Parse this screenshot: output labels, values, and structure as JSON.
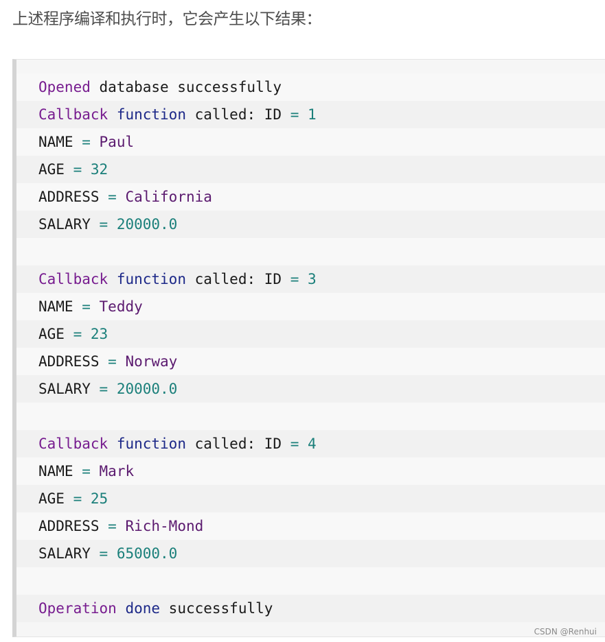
{
  "intro_text": "上述程序编译和执行时，它会产生以下结果：",
  "watermark": "CSDN @Renhui",
  "lines": [
    [
      {
        "t": "Opened",
        "c": "kw"
      },
      {
        "t": " database successfully",
        "c": "plain"
      }
    ],
    [
      {
        "t": "Callback",
        "c": "kw"
      },
      {
        "t": " ",
        "c": "plain"
      },
      {
        "t": "function",
        "c": "fn"
      },
      {
        "t": " called: ID ",
        "c": "plain"
      },
      {
        "t": "=",
        "c": "num"
      },
      {
        "t": " ",
        "c": "plain"
      },
      {
        "t": "1",
        "c": "num"
      }
    ],
    [
      {
        "t": "NAME ",
        "c": "plain"
      },
      {
        "t": "=",
        "c": "num"
      },
      {
        "t": " ",
        "c": "plain"
      },
      {
        "t": "Paul",
        "c": "str"
      }
    ],
    [
      {
        "t": "AGE ",
        "c": "plain"
      },
      {
        "t": "=",
        "c": "num"
      },
      {
        "t": " ",
        "c": "plain"
      },
      {
        "t": "32",
        "c": "num"
      }
    ],
    [
      {
        "t": "ADDRESS ",
        "c": "plain"
      },
      {
        "t": "=",
        "c": "num"
      },
      {
        "t": " ",
        "c": "plain"
      },
      {
        "t": "California",
        "c": "str"
      }
    ],
    [
      {
        "t": "SALARY ",
        "c": "plain"
      },
      {
        "t": "=",
        "c": "num"
      },
      {
        "t": " ",
        "c": "plain"
      },
      {
        "t": "20000.0",
        "c": "num"
      }
    ],
    [],
    [
      {
        "t": "Callback",
        "c": "kw"
      },
      {
        "t": " ",
        "c": "plain"
      },
      {
        "t": "function",
        "c": "fn"
      },
      {
        "t": " called: ID ",
        "c": "plain"
      },
      {
        "t": "=",
        "c": "num"
      },
      {
        "t": " ",
        "c": "plain"
      },
      {
        "t": "3",
        "c": "num"
      }
    ],
    [
      {
        "t": "NAME ",
        "c": "plain"
      },
      {
        "t": "=",
        "c": "num"
      },
      {
        "t": " ",
        "c": "plain"
      },
      {
        "t": "Teddy",
        "c": "str"
      }
    ],
    [
      {
        "t": "AGE ",
        "c": "plain"
      },
      {
        "t": "=",
        "c": "num"
      },
      {
        "t": " ",
        "c": "plain"
      },
      {
        "t": "23",
        "c": "num"
      }
    ],
    [
      {
        "t": "ADDRESS ",
        "c": "plain"
      },
      {
        "t": "=",
        "c": "num"
      },
      {
        "t": " ",
        "c": "plain"
      },
      {
        "t": "Norway",
        "c": "str"
      }
    ],
    [
      {
        "t": "SALARY ",
        "c": "plain"
      },
      {
        "t": "=",
        "c": "num"
      },
      {
        "t": " ",
        "c": "plain"
      },
      {
        "t": "20000.0",
        "c": "num"
      }
    ],
    [],
    [
      {
        "t": "Callback",
        "c": "kw"
      },
      {
        "t": " ",
        "c": "plain"
      },
      {
        "t": "function",
        "c": "fn"
      },
      {
        "t": " called: ID ",
        "c": "plain"
      },
      {
        "t": "=",
        "c": "num"
      },
      {
        "t": " ",
        "c": "plain"
      },
      {
        "t": "4",
        "c": "num"
      }
    ],
    [
      {
        "t": "NAME ",
        "c": "plain"
      },
      {
        "t": "=",
        "c": "num"
      },
      {
        "t": " ",
        "c": "plain"
      },
      {
        "t": "Mark",
        "c": "str"
      }
    ],
    [
      {
        "t": "AGE ",
        "c": "plain"
      },
      {
        "t": "=",
        "c": "num"
      },
      {
        "t": " ",
        "c": "plain"
      },
      {
        "t": "25",
        "c": "num"
      }
    ],
    [
      {
        "t": "ADDRESS ",
        "c": "plain"
      },
      {
        "t": "=",
        "c": "num"
      },
      {
        "t": " ",
        "c": "plain"
      },
      {
        "t": "Rich-Mond",
        "c": "str"
      }
    ],
    [
      {
        "t": "SALARY ",
        "c": "plain"
      },
      {
        "t": "=",
        "c": "num"
      },
      {
        "t": " ",
        "c": "plain"
      },
      {
        "t": "65000.0",
        "c": "num"
      }
    ],
    [],
    [
      {
        "t": "Operation",
        "c": "kw"
      },
      {
        "t": " ",
        "c": "plain"
      },
      {
        "t": "done",
        "c": "fn"
      },
      {
        "t": " successfully",
        "c": "plain"
      }
    ]
  ]
}
